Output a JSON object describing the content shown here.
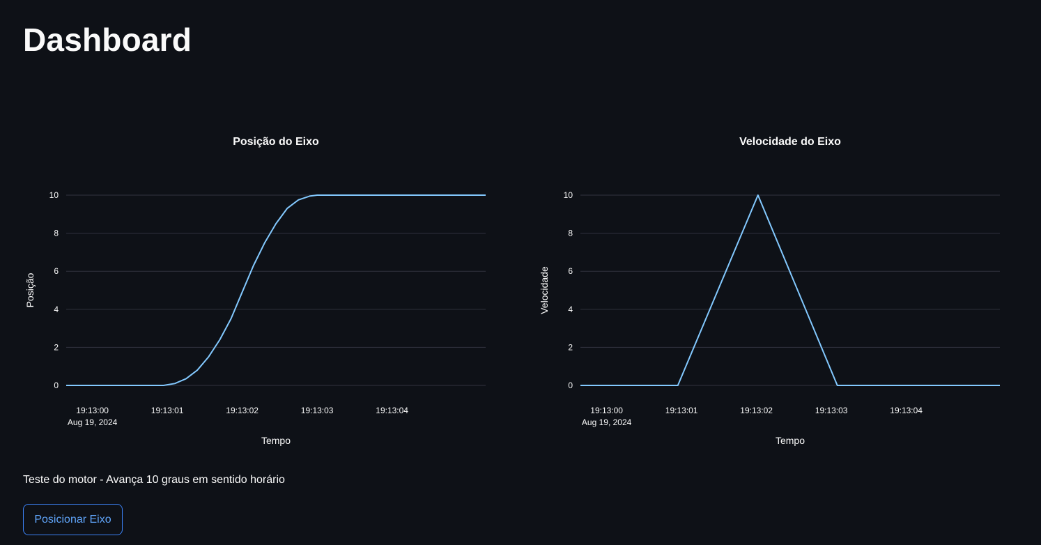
{
  "page": {
    "title": "Dashboard"
  },
  "caption": "Teste do motor - Avança 10 graus em sentido horário",
  "button": {
    "label": "Posicionar Eixo"
  },
  "colors": {
    "background": "#0e1117",
    "line": "#83c9ff",
    "grid": "#31333f",
    "accent": "#3b82f6"
  },
  "chart_data": [
    {
      "type": "line",
      "title": "Posição do Eixo",
      "xlabel": "Tempo",
      "ylabel": "Posição",
      "ylim": [
        0,
        10
      ],
      "yticks": [
        0,
        2,
        4,
        6,
        8,
        10
      ],
      "xlim": [
        "2024-08-19T19:12:59.65",
        "2024-08-19T19:13:05.25"
      ],
      "xticks": [
        {
          "t": "2024-08-19T19:13:00",
          "label": "19:13:00",
          "sublabel": "Aug 19, 2024"
        },
        {
          "t": "2024-08-19T19:13:01",
          "label": "19:13:01"
        },
        {
          "t": "2024-08-19T19:13:02",
          "label": "19:13:02"
        },
        {
          "t": "2024-08-19T19:13:03",
          "label": "19:13:03"
        },
        {
          "t": "2024-08-19T19:13:04",
          "label": "19:13:04"
        }
      ],
      "grid": true,
      "series": [
        {
          "x": [
            "2024-08-19T19:12:59.65",
            "2024-08-19T19:13:00.95",
            "2024-08-19T19:13:01.1",
            "2024-08-19T19:13:01.25",
            "2024-08-19T19:13:01.4",
            "2024-08-19T19:13:01.55",
            "2024-08-19T19:13:01.7",
            "2024-08-19T19:13:01.85",
            "2024-08-19T19:13:02.0",
            "2024-08-19T19:13:02.15",
            "2024-08-19T19:13:02.3",
            "2024-08-19T19:13:02.45",
            "2024-08-19T19:13:02.6",
            "2024-08-19T19:13:02.75",
            "2024-08-19T19:13:02.9",
            "2024-08-19T19:13:03.0",
            "2024-08-19T19:13:05.25"
          ],
          "y": [
            0,
            0,
            0.1,
            0.35,
            0.8,
            1.5,
            2.4,
            3.5,
            4.9,
            6.3,
            7.5,
            8.5,
            9.3,
            9.75,
            9.95,
            10,
            10
          ]
        }
      ]
    },
    {
      "type": "line",
      "title": "Velocidade do Eixo",
      "xlabel": "Tempo",
      "ylabel": "Velocidade",
      "ylim": [
        0,
        10
      ],
      "yticks": [
        0,
        2,
        4,
        6,
        8,
        10
      ],
      "xlim": [
        "2024-08-19T19:12:59.65",
        "2024-08-19T19:13:05.25"
      ],
      "xticks": [
        {
          "t": "2024-08-19T19:13:00",
          "label": "19:13:00",
          "sublabel": "Aug 19, 2024"
        },
        {
          "t": "2024-08-19T19:13:01",
          "label": "19:13:01"
        },
        {
          "t": "2024-08-19T19:13:02",
          "label": "19:13:02"
        },
        {
          "t": "2024-08-19T19:13:03",
          "label": "19:13:03"
        },
        {
          "t": "2024-08-19T19:13:04",
          "label": "19:13:04"
        }
      ],
      "grid": true,
      "series": [
        {
          "x": [
            "2024-08-19T19:12:59.65",
            "2024-08-19T19:13:00.95",
            "2024-08-19T19:13:02.02",
            "2024-08-19T19:13:03.08",
            "2024-08-19T19:13:05.25"
          ],
          "y": [
            0,
            0,
            10,
            0,
            0
          ]
        }
      ]
    }
  ]
}
